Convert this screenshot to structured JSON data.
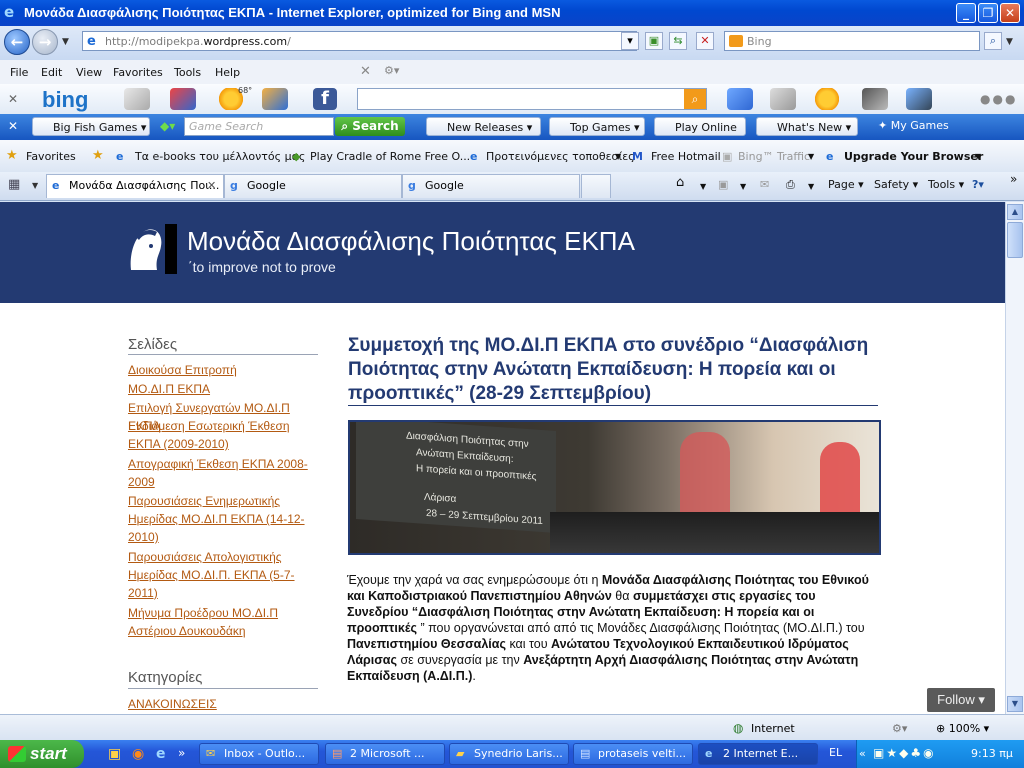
{
  "window": {
    "title": "Μονάδα Διασφάλισης Ποιότητας ΕΚΠΑ - Internet Explorer, optimized for Bing and MSN",
    "min_icon": "minimize-icon",
    "max_icon": "maximize-icon",
    "close_icon": "close-icon"
  },
  "address": {
    "url_prefix": "http://modipekpa.",
    "url_domain": "wordpress.com",
    "url_suffix": "/",
    "search_placeholder": "Bing"
  },
  "menu": [
    "File",
    "Edit",
    "View",
    "Favorites",
    "Tools",
    "Help"
  ],
  "bingbar": {
    "logo": "bing",
    "weather": "68°"
  },
  "gamesbar": {
    "big_fish": "Big Fish Games",
    "search_placeholder": "Game Search",
    "search_btn": "Search",
    "new_releases": "New Releases",
    "top_games": "Top Games",
    "play_online": "Play Online",
    "whats_new": "What's New",
    "my_games": "My Games"
  },
  "favorites": {
    "label": "Favorites",
    "items": [
      "Τα e-books του μέλλοντός μας",
      "Play Cradle of Rome Free O...",
      "Προτεινόμενες τοποθεσίες",
      "Free Hotmail",
      "Bing™ Traffic",
      "Upgrade Your Browser"
    ]
  },
  "tabs": [
    {
      "label": "Μονάδα Διασφάλισης Ποι..."
    },
    {
      "label": "Google"
    },
    {
      "label": "Google"
    }
  ],
  "commands": {
    "page": "Page",
    "safety": "Safety",
    "tools": "Tools"
  },
  "site": {
    "title": "Μονάδα Διασφάλισης Ποιότητας ΕΚΠΑ",
    "tagline": "΄to improve not to prove"
  },
  "sidebar": {
    "pages_heading": "Σελίδες",
    "pages": [
      "Διοικούσα Επιτροπή",
      "ΜΟ.ΔΙ.Π ΕΚΠΑ",
      "Επιλογή Συνεργατών ΜΟ.ΔΙ.Π ΕΚΠΑ",
      "Ενδιάμεση Εσωτερική Έκθεση ΕΚΠΑ (2009-2010)",
      "Απογραφική Έκθεση ΕΚΠΑ 2008-2009",
      "Παρουσιάσεις Ενημερωτικής Ημερίδας ΜΟ.ΔΙ.Π ΕΚΠΑ (14-12-2010)",
      "Παρουσιάσεις Απολογιστικής Ημερίδας ΜΟ.ΔΙ.Π. ΕΚΠΑ (5-7-2011)",
      "Μήνυμα Προέδρου ΜΟ.ΔΙ.Π Αστέριου Δουκουδάκη"
    ],
    "categories_heading": "Κατηγορίες",
    "categories": [
      "ΑΝΑΚΟΙΝΩΣΕΙΣ"
    ]
  },
  "post": {
    "title": "Συμμετοχή της ΜΟ.ΔΙ.Π ΕΚΠΑ στο συνέδριο “Διασφάλιση Ποιότητας στην Ανώτατη Εκπαίδευση: Η πορεία και οι προοπτικές” (28-29 Σεπτεμβρίου)",
    "image_lines": [
      "Διασφάλιση Ποιότητας στην",
      "Ανώτατη Εκπαίδευση:",
      "Η πορεία και οι προοπτικές",
      "Λάρισα",
      "28 – 29 Σεπτεμβρίου 2011"
    ],
    "t1": "Έχουμε την χαρά να σας ενημερώσουμε ότι η ",
    "b1": "Μονάδα Διασφάλισης Ποιότητας του Εθνικού και Καποδιστριακού Πανεπιστημίου Αθηνών",
    "t2": " θα ",
    "b2": "συμμετάσχει στις εργασίες του Συνεδρίου “Διασφάλιση Ποιότητας στην Ανώτατη Εκπαίδευση: Η πορεία και οι προοπτικές",
    "t3": " ” που οργανώνεται από από τις Μονάδες Διασφάλισης Ποιότητας (ΜΟ.ΔΙ.Π.) του ",
    "b3": "Πανεπιστημίου Θεσσαλίας",
    "t4": " και του ",
    "b4": "Ανώτατου Τεχνολογικού Εκπαιδευτικού Ιδρύματος Λάρισας",
    "t5": " σε συνεργασία με την ",
    "b5": "Ανεξάρτητη Αρχή Διασφάλισης Ποιότητας στην Ανώτατη Εκπαίδευση (Α.ΔΙ.Π.)",
    "t6": "."
  },
  "follow": "Follow",
  "status": {
    "zone": "Internet",
    "zoom": "100%"
  },
  "taskbar": {
    "start": "start",
    "tasks": [
      "Inbox - Outlo...",
      "2 Microsoft ...",
      "Synedrio Laris...",
      "protaseis velti...",
      "2 Internet E..."
    ],
    "lang": "EL",
    "clock": "9:13 πμ"
  }
}
